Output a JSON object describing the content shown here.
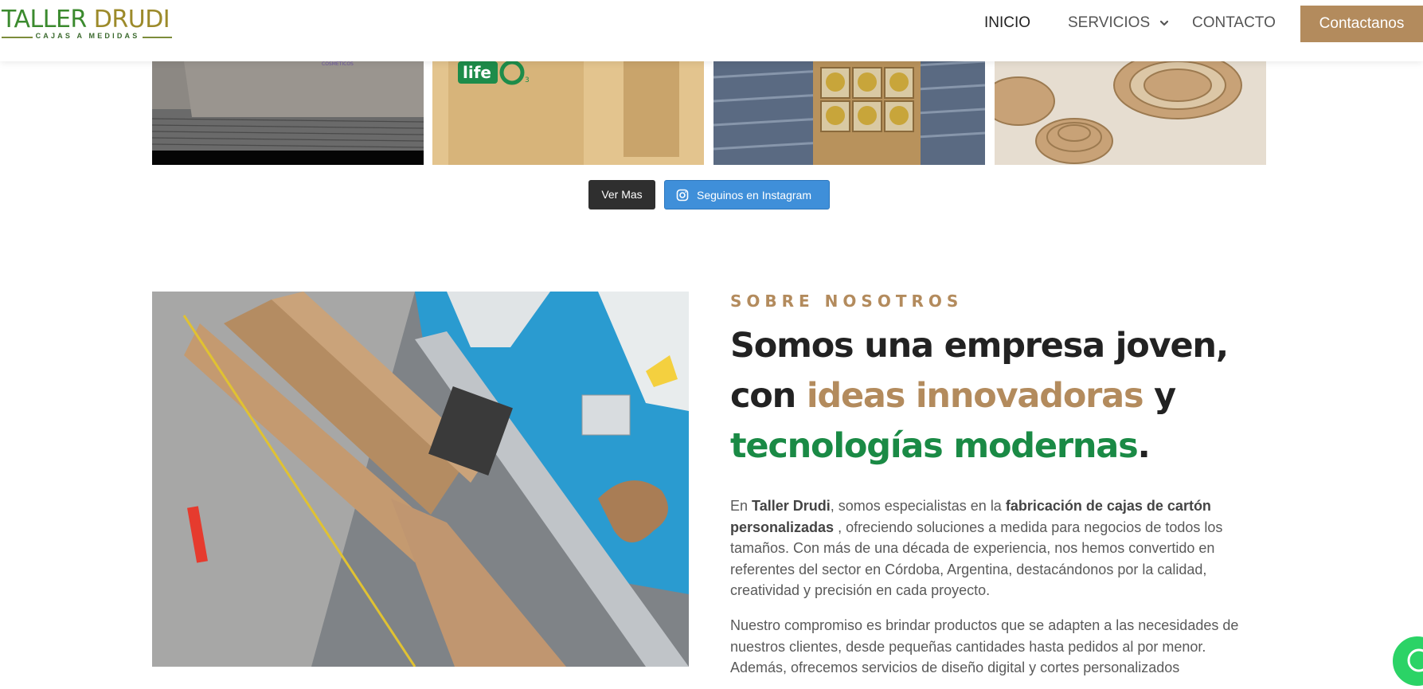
{
  "header": {
    "logo": {
      "title_part1": "TALLER ",
      "title_part2": "DRUDI",
      "subtitle": "CAJAS A MEDIDAS"
    },
    "nav": [
      {
        "label": "INICIO",
        "active": true
      },
      {
        "label": "SERVICIOS",
        "has_dropdown": true
      },
      {
        "label": "CONTACTO"
      }
    ],
    "cta_label": "Contactanos",
    "colors": {
      "cta_bg": "#b38b5d",
      "logo_green": "#3b8a2e",
      "logo_olive": "#9c8a2a"
    }
  },
  "gallery": {
    "tiles": [
      {
        "name": "gallery-tile-stacked-boxes",
        "caption_text": "COSMETICOS"
      },
      {
        "name": "gallery-tile-life-o3-box",
        "brand_text": "life",
        "brand_sub": "3"
      },
      {
        "name": "gallery-tile-jar-divider-box"
      },
      {
        "name": "gallery-tile-cardboard-rings"
      }
    ],
    "buttons": {
      "more_label": "Ver Mas",
      "instagram_label": "Seguinos en Instagram"
    }
  },
  "about": {
    "kicker": "SOBRE NOSOTROS",
    "headline": {
      "part1": "Somos una empresa joven, con ",
      "highlight1": "ideas innovadoras",
      "part2": " y ",
      "highlight2": "tecnologías modernas",
      "end": "."
    },
    "p1": {
      "t1": "En ",
      "b1": "Taller Drudi",
      "t2": ", somos especialistas en la ",
      "b2": "fabricación de cajas de cartón personalizadas",
      "t3": " , ofreciendo soluciones a medida para negocios de todos los tamaños. Con más de una década de experiencia, nos hemos convertido en referentes del sector en Córdoba, Argentina, destacándonos por la calidad, creatividad y precisión en cada proyecto."
    },
    "p2": "Nuestro compromiso es brindar productos que se adapten a las necesidades de nuestros clientes, desde pequeñas cantidades hasta pedidos al por menor. Además, ofrecemos servicios de diseño digital y cortes personalizados",
    "colors": {
      "kicker": "#b38b5d",
      "highlight_brown": "#b38b5d",
      "highlight_green": "#1a8a45"
    }
  },
  "whatsapp": {
    "icon": "whatsapp-icon",
    "color": "#2bd366"
  }
}
